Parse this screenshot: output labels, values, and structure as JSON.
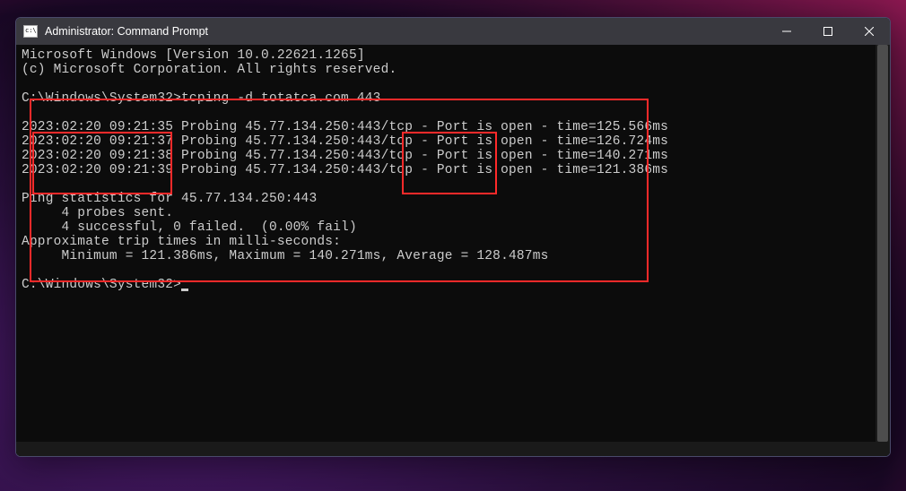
{
  "titlebar": {
    "title": "Administrator: Command Prompt"
  },
  "banner": {
    "line1": "Microsoft Windows [Version 10.0.22621.1265]",
    "line2": "(c) Microsoft Corporation. All rights reserved."
  },
  "prompt1": {
    "path": "C:\\Windows\\System32>",
    "command": "tcping -d totatca.com 443"
  },
  "probes": [
    {
      "ts": "2023:02:20 09:21:35",
      "probe": "Probing 45.77.134.250:443/tcp -",
      "status": "Port is open",
      "time": "- time=125.566ms"
    },
    {
      "ts": "2023:02:20 09:21:37",
      "probe": "Probing 45.77.134.250:443/tcp -",
      "status": "Port is open",
      "time": "- time=126.724ms"
    },
    {
      "ts": "2023:02:20 09:21:38",
      "probe": "Probing 45.77.134.250:443/tcp -",
      "status": "Port is open",
      "time": "- time=140.271ms"
    },
    {
      "ts": "2023:02:20 09:21:39",
      "probe": "Probing 45.77.134.250:443/tcp -",
      "status": "Port is open",
      "time": "- time=121.386ms"
    }
  ],
  "stats": {
    "header": "Ping statistics for 45.77.134.250:443",
    "sent": "     4 probes sent.",
    "result": "     4 successful, 0 failed.  (0.00% fail)",
    "approx": "Approximate trip times in milli-seconds:",
    "times": "     Minimum = 121.386ms, Maximum = 140.271ms, Average = 128.487ms"
  },
  "prompt2": {
    "path": "C:\\Windows\\System32>"
  }
}
